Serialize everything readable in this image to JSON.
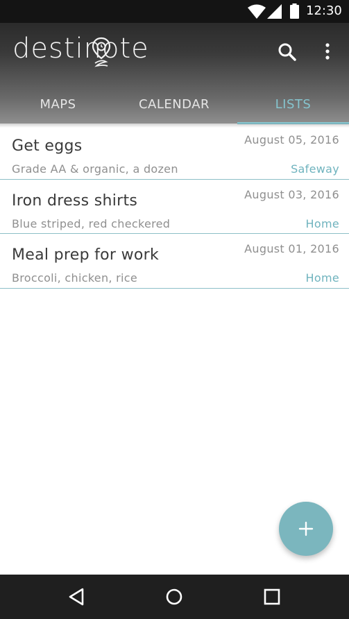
{
  "status_bar": {
    "time": "12:30",
    "icons": [
      "wifi-icon",
      "signal-icon",
      "battery-icon"
    ]
  },
  "app": {
    "logo_text": "destinote",
    "actions": [
      "search-icon",
      "more-vert-icon"
    ]
  },
  "tabs": [
    {
      "label": "MAPS",
      "selected": false
    },
    {
      "label": "CALENDAR",
      "selected": false
    },
    {
      "label": "LISTS",
      "selected": true
    }
  ],
  "items": [
    {
      "title": "Get eggs",
      "date": "August 05, 2016",
      "subtitle": "Grade AA & organic, a dozen",
      "place": "Safeway"
    },
    {
      "title": "Iron dress shirts",
      "date": "August 03, 2016",
      "subtitle": "Blue striped, red checkered",
      "place": "Home"
    },
    {
      "title": "Meal prep for work",
      "date": "August 01, 2016",
      "subtitle": "Broccoli, chicken, rice",
      "place": "Home"
    }
  ],
  "fab": {
    "icon": "plus-icon"
  },
  "nav": {
    "icons": [
      "back-icon",
      "home-icon",
      "recents-icon"
    ]
  },
  "colors": {
    "accent": "#86c5cf",
    "fab": "#7bb6be",
    "divider": "#8cbfc7",
    "place_text": "#6fb3be"
  }
}
